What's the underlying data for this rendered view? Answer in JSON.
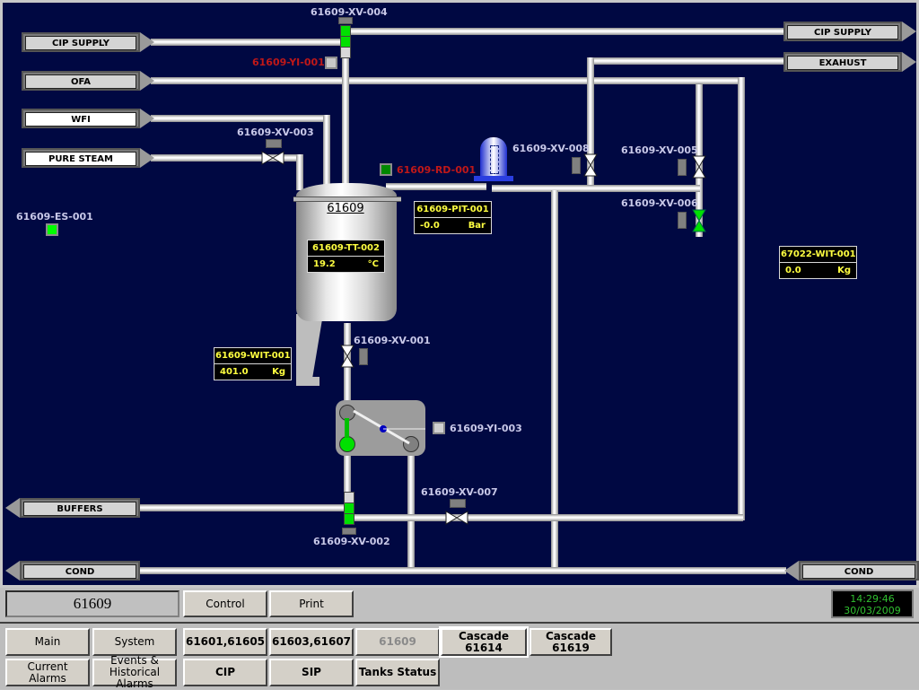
{
  "unit": "61609",
  "connectors": {
    "cip_supply_in": "CIP SUPPLY",
    "ofa": "OFA",
    "wfi": "WFI",
    "pure_steam": "PURE STEAM",
    "cip_supply_out": "CIP SUPPLY",
    "exhaust": "EXAHUST",
    "buffers": "BUFFERS",
    "cond_left": "COND",
    "cond_right": "COND"
  },
  "tags": {
    "xv004": "61609-XV-004",
    "yi001": "61609-YI-001",
    "xv003": "61609-XV-003",
    "rd001": "61609-RD-001",
    "es001": "61609-ES-001",
    "xv008": "61609-XV-008",
    "xv005": "61609-XV-005",
    "xv006": "61609-XV-006",
    "xv001": "61609-XV-001",
    "yi003": "61609-YI-003",
    "xv007": "61609-XV-007",
    "xv002": "61609-XV-002",
    "tank_name": "61609"
  },
  "displays": {
    "tt002": {
      "tag": "61609-TT-002",
      "value": "19.2",
      "unit": "°C"
    },
    "pit001": {
      "tag": "61609-PIT-001",
      "value": "-0.0",
      "unit": "Bar"
    },
    "wit001": {
      "tag": "61609-WIT-001",
      "value": "401.0",
      "unit": "Kg"
    },
    "wit67022": {
      "tag": "67022-WIT-001",
      "value": "0.0",
      "unit": "Kg"
    }
  },
  "colors": {
    "background": "#000842",
    "valve_open": "#00e000",
    "tag_text": "#c8c8e8",
    "alarm_text": "#c01818",
    "display_text": "#ffff40"
  },
  "statusbar": {
    "unit_label": "61609",
    "control": "Control",
    "print": "Print",
    "time": "14:29:46",
    "date": "30/03/2009"
  },
  "nav": {
    "main": "Main",
    "system": "System",
    "current_alarms": "Current Alarms",
    "events": "Events & Historical Alarms",
    "n1": "61601,61605",
    "n2": "61603,61607",
    "n3": "61609",
    "cascade1": "Cascade 61614",
    "cascade2": "Cascade 61619",
    "cip": "CIP",
    "sip": "SIP",
    "tanks": "Tanks Status"
  }
}
